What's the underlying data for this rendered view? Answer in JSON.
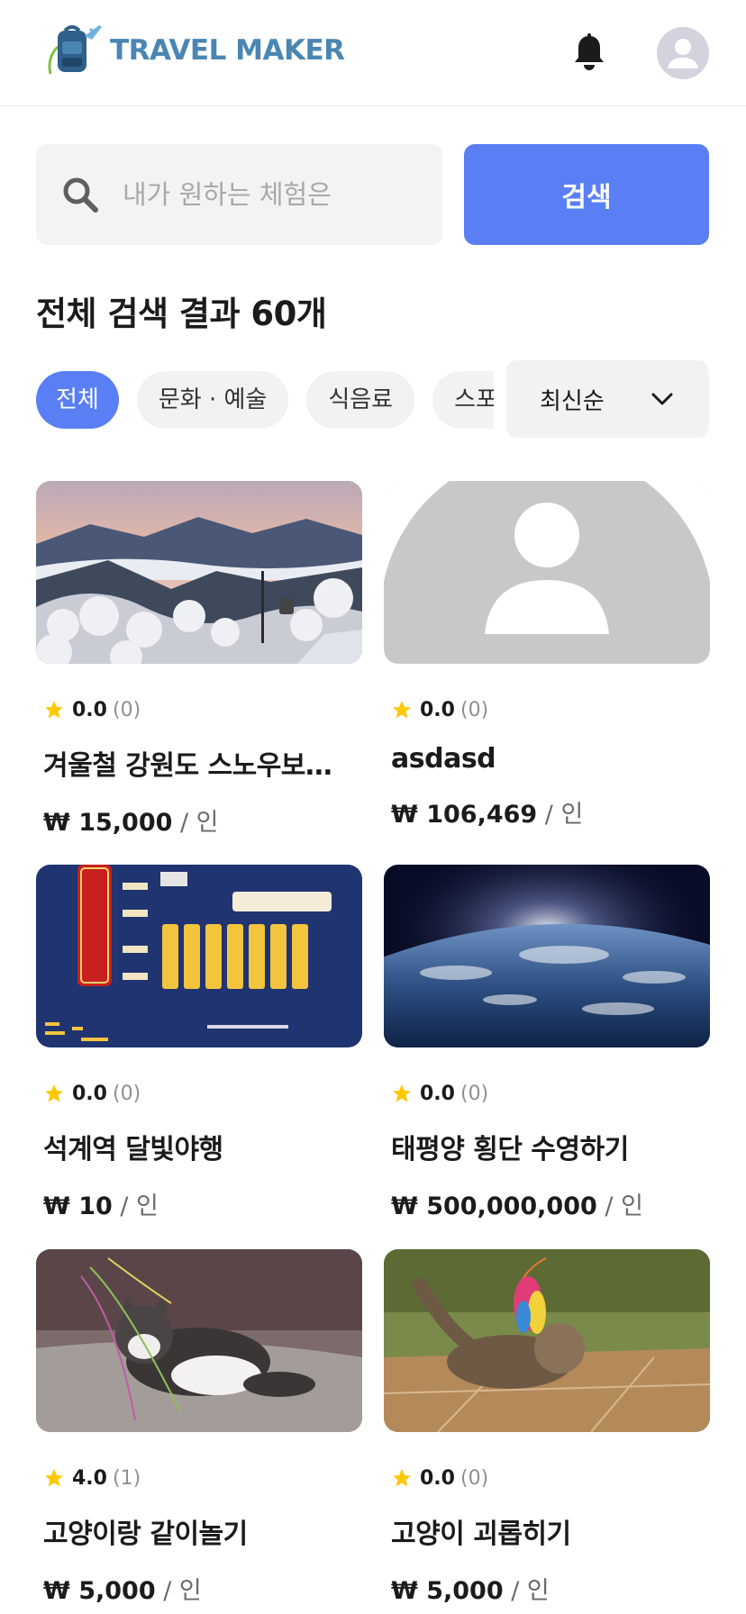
{
  "header": {
    "logo_text": "TRAVEL MAKER",
    "icons": {
      "bell": "bell-icon",
      "avatar": "user-avatar-icon"
    }
  },
  "search": {
    "placeholder": "내가 원하는 체험은",
    "button_label": "검색"
  },
  "results": {
    "title": "전체 검색 결과 60개"
  },
  "filters": {
    "chips": [
      "전체",
      "문화 · 예술",
      "식음료",
      "스포츠"
    ],
    "active_index": 0
  },
  "sort": {
    "selected": "최신순"
  },
  "colors": {
    "accent": "#5a7ff5",
    "star": "#ffc800",
    "logo": "#4a86b3"
  },
  "cards": [
    {
      "rating": "0.0",
      "count": "(0)",
      "title": "겨울철 강원도 스노우보드 체험",
      "currency": "₩",
      "amount": "15,000",
      "unit": "/ 인",
      "image": "snowy-mountain-image"
    },
    {
      "rating": "0.0",
      "count": "(0)",
      "title": "asdasd",
      "currency": "₩",
      "amount": "106,469",
      "unit": "/ 인",
      "image": "default-profile-image"
    },
    {
      "rating": "0.0",
      "count": "(0)",
      "title": "석계역 달빛야행",
      "currency": "₩",
      "amount": "10",
      "unit": "/ 인",
      "image": "night-market-poster-image"
    },
    {
      "rating": "0.0",
      "count": "(0)",
      "title": "태평양 횡단 수영하기",
      "currency": "₩",
      "amount": "500,000,000",
      "unit": "/ 인",
      "image": "earth-from-space-image"
    },
    {
      "rating": "4.0",
      "count": "(1)",
      "title": "고양이랑 같이놀기",
      "currency": "₩",
      "amount": "5,000",
      "unit": "/ 인",
      "image": "kitten-playing-image"
    },
    {
      "rating": "0.0",
      "count": "(0)",
      "title": "고양이 괴롭히기",
      "currency": "₩",
      "amount": "5,000",
      "unit": "/ 인",
      "image": "kitten-feather-toy-image"
    }
  ]
}
